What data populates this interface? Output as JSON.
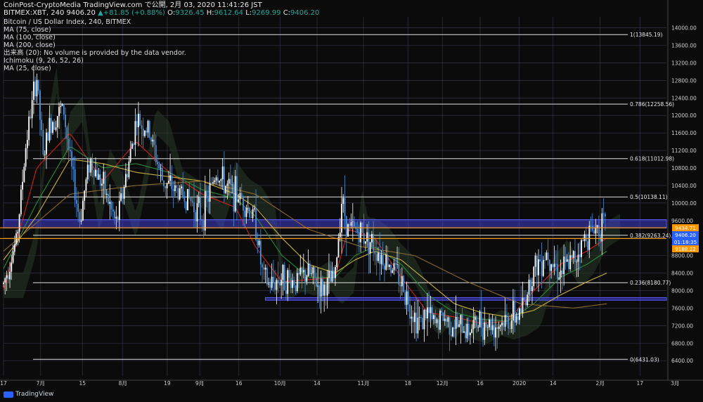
{
  "header": {
    "line1": "CoinPost-CryptoMedia TradingView.com で公開, 2月 03, 2020 11:41:26 JST",
    "symbol": "BITMEX:XBT, 240",
    "last": "9406.20",
    "change": "+81.85 (+0.88%)",
    "o_label": "O:",
    "o": "9326.45",
    "h_label": "H:",
    "h": "9612.64",
    "l_label": "L:",
    "l": "9269.99",
    "c_label": "C:",
    "c": "9406.20"
  },
  "indicators": [
    "Bitcoin / US Dollar Index, 240, BITMEX",
    "MA (75, close)",
    "MA (100, close)",
    "MA (200, close)",
    "出来高 (20): No volume is provided by the data vendor.",
    "Ichimoku (9, 26, 52, 26)",
    "MA (25, close)"
  ],
  "footer": {
    "logo_text": "TradingView",
    "logo_icon": "tradingview-logo-icon"
  },
  "colors": {
    "background": "#0b0b0b",
    "grid": "#3a3a52",
    "candle_up": "#ffffff",
    "candle_down": "#4a8fd8",
    "fib_line": "#e0e0e0",
    "support_band": "#3f3fd0",
    "price_line": "#ff9800",
    "ma25": "#d02020",
    "ma75": "#2a8a3a",
    "ma100": "#c8b040",
    "ma200": "#8a6a30",
    "cloud": "#2a3a2a",
    "price_tag_bg": "#ff9800",
    "price_tag_blue": "#2962ff"
  },
  "chart_data": {
    "type": "line",
    "title": "Bitcoin / US Dollar Index, 240, BITMEX",
    "xlabel": "",
    "ylabel": "",
    "grid": true,
    "ylim": [
      6050,
      14250
    ],
    "y_ticks": [
      6400,
      6800,
      7200,
      7600,
      8000,
      8400,
      8800,
      9200,
      9600,
      10000,
      10400,
      10800,
      11200,
      11600,
      12000,
      12400,
      12800,
      13200,
      13600,
      14000
    ],
    "y_tick_labels": [
      "6400.00",
      "6800.00",
      "7200.00",
      "7600.00",
      "8000.00",
      "8400.00",
      "8800.00",
      "9200.00",
      "9600.00",
      "10000.00",
      "10400.00",
      "10800.00",
      "11200.00",
      "11600.00",
      "12000.00",
      "12400.00",
      "12800.00",
      "13200.00",
      "13600.00",
      "14000.00"
    ],
    "x_ticks": [
      {
        "label": "17",
        "t": 0.0
      },
      {
        "label": "7月",
        "t": 0.056
      },
      {
        "label": "15",
        "t": 0.119
      },
      {
        "label": "8月",
        "t": 0.18
      },
      {
        "label": "19",
        "t": 0.247
      },
      {
        "label": "9月",
        "t": 0.296
      },
      {
        "label": "16",
        "t": 0.355
      },
      {
        "label": "10月",
        "t": 0.417
      },
      {
        "label": "14",
        "t": 0.473
      },
      {
        "label": "11月",
        "t": 0.543
      },
      {
        "label": "18",
        "t": 0.61
      },
      {
        "label": "12月",
        "t": 0.662
      },
      {
        "label": "16",
        "t": 0.719
      },
      {
        "label": "2020",
        "t": 0.778
      },
      {
        "label": "14",
        "t": 0.829
      },
      {
        "label": "2月",
        "t": 0.9
      },
      {
        "label": "17",
        "t": 0.96
      },
      {
        "label": "3月",
        "t": 1.013
      }
    ],
    "fib_levels": [
      {
        "label": "1(13845.19)",
        "value": 13845.19
      },
      {
        "label": "0.786(12258.56)",
        "value": 12258.56
      },
      {
        "label": "0.618(11012.98)",
        "value": 11012.98
      },
      {
        "label": "0.5(10138.11)",
        "value": 10138.11
      },
      {
        "label": "0.382(9263.24)",
        "value": 9263.24
      },
      {
        "label": "0.236(8180.77)",
        "value": 8180.77
      },
      {
        "label": "0(6431.03)",
        "value": 6431.03
      }
    ],
    "support_zones": [
      {
        "from": 9430,
        "to": 9620,
        "t_from": 0.0,
        "t_to": 1.0
      },
      {
        "from": 7780,
        "to": 7840,
        "t_from": 0.395,
        "t_to": 1.0
      }
    ],
    "price_tags": [
      {
        "label": "9434.71",
        "value": 9434.71,
        "color": "#ff9800"
      },
      {
        "label": "9406.20",
        "value": 9406.2,
        "color": "#2962ff"
      },
      {
        "label": "01:18:35",
        "value": 9330,
        "color": "#2962ff"
      },
      {
        "label": "9188.22",
        "value": 9188.22,
        "color": "#ff9800"
      }
    ],
    "series": [
      {
        "name": "Bitcoin / US Dollar Index",
        "values_t": [
          0.0,
          0.02,
          0.035,
          0.05,
          0.06,
          0.07,
          0.09,
          0.1,
          0.115,
          0.13,
          0.15,
          0.17,
          0.19,
          0.2,
          0.22,
          0.24,
          0.26,
          0.28,
          0.3,
          0.32,
          0.34,
          0.36,
          0.38,
          0.39,
          0.4,
          0.42,
          0.44,
          0.46,
          0.48,
          0.5,
          0.51,
          0.52,
          0.53,
          0.54,
          0.55,
          0.57,
          0.59,
          0.6,
          0.62,
          0.63,
          0.64,
          0.65,
          0.66,
          0.68,
          0.7,
          0.72,
          0.74,
          0.76,
          0.78,
          0.8,
          0.82,
          0.84,
          0.86,
          0.88,
          0.9,
          0.91
        ],
        "values": [
          8150,
          9200,
          11500,
          12900,
          11000,
          11800,
          12200,
          11000,
          9600,
          11000,
          10400,
          9500,
          11000,
          11900,
          11600,
          10500,
          10300,
          10100,
          9700,
          10700,
          10300,
          10100,
          9600,
          8400,
          8100,
          8300,
          8200,
          8400,
          8000,
          8300,
          10100,
          9400,
          9400,
          9300,
          9200,
          8800,
          8500,
          8200,
          7400,
          7300,
          7500,
          7200,
          7400,
          7200,
          7100,
          7300,
          7200,
          7300,
          7500,
          8500,
          8900,
          8400,
          8700,
          9300,
          9500,
          9406
        ]
      },
      {
        "name": "MA (25, close)",
        "values_t": [
          0.0,
          0.05,
          0.1,
          0.15,
          0.2,
          0.25,
          0.3,
          0.35,
          0.38,
          0.42,
          0.46,
          0.5,
          0.52,
          0.56,
          0.6,
          0.64,
          0.68,
          0.72,
          0.76,
          0.8,
          0.84,
          0.88,
          0.91
        ],
        "values": [
          8000,
          10800,
          11600,
          10500,
          11400,
          10700,
          10200,
          9900,
          9000,
          8200,
          8250,
          8300,
          9400,
          9200,
          8300,
          7500,
          7400,
          7250,
          7300,
          8000,
          8600,
          8900,
          9200
        ]
      },
      {
        "name": "MA (75, close)",
        "values_t": [
          0.0,
          0.05,
          0.1,
          0.15,
          0.2,
          0.25,
          0.3,
          0.35,
          0.38,
          0.42,
          0.46,
          0.5,
          0.53,
          0.56,
          0.6,
          0.64,
          0.68,
          0.72,
          0.76,
          0.8,
          0.84,
          0.88,
          0.91
        ],
        "values": [
          8500,
          10000,
          11300,
          10800,
          10900,
          10700,
          10300,
          10100,
          9700,
          8800,
          8300,
          8300,
          8800,
          9000,
          8600,
          7900,
          7500,
          7350,
          7300,
          7700,
          8300,
          8600,
          8900
        ]
      },
      {
        "name": "MA (100, close)",
        "values_t": [
          0.0,
          0.05,
          0.1,
          0.15,
          0.2,
          0.25,
          0.3,
          0.35,
          0.38,
          0.42,
          0.46,
          0.5,
          0.53,
          0.56,
          0.6,
          0.64,
          0.68,
          0.72,
          0.76,
          0.8,
          0.84,
          0.88,
          0.91
        ],
        "values": [
          8700,
          9700,
          11000,
          10900,
          10700,
          10600,
          10500,
          10200,
          9900,
          9200,
          8600,
          8400,
          8700,
          8900,
          8700,
          8200,
          7700,
          7500,
          7400,
          7550,
          7900,
          8200,
          8400
        ]
      },
      {
        "name": "MA (200, close)",
        "values_t": [
          0.0,
          0.1,
          0.2,
          0.3,
          0.38,
          0.46,
          0.54,
          0.62,
          0.7,
          0.78,
          0.86,
          0.91
        ],
        "values": [
          8900,
          10200,
          10400,
          10500,
          10200,
          9400,
          9000,
          8800,
          8200,
          7700,
          7600,
          7700
        ]
      }
    ]
  }
}
